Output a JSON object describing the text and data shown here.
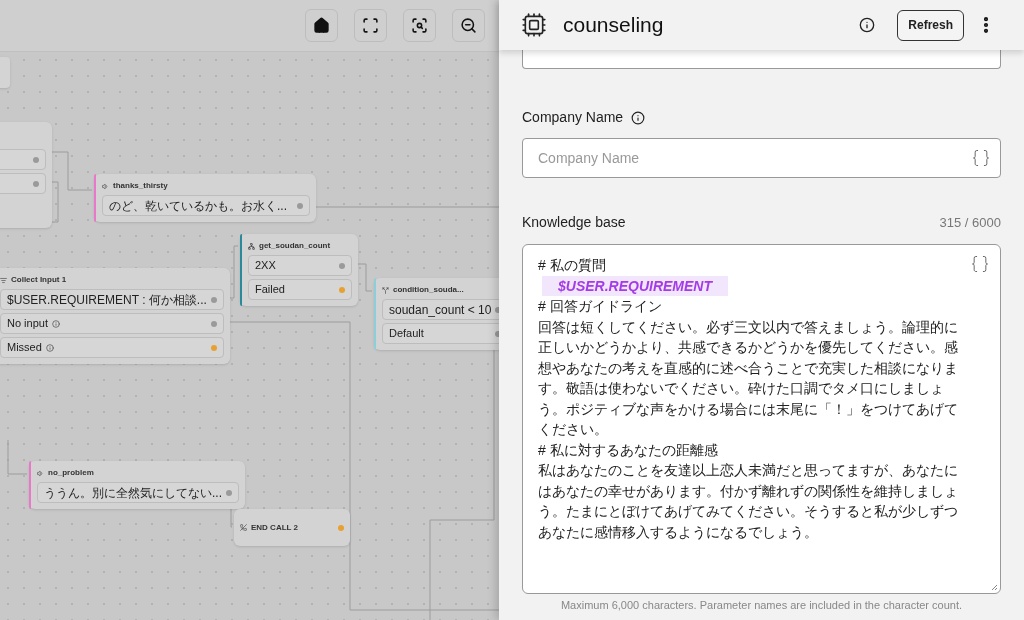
{
  "canvas": {
    "nodes": [
      {
        "kind": "stub"
      },
      {
        "kind": "partial",
        "rows": [
          {
            "color": "#9a9a9a"
          },
          {
            "color": "#9a9a9a"
          }
        ]
      },
      {
        "kind": "speak",
        "title": "thanks_thirsty",
        "color": "#e879c9",
        "rows": [
          {
            "label": "のど、乾いているかも。お水く...",
            "info": false,
            "color": "#9a9a9a"
          }
        ]
      },
      {
        "kind": "api",
        "title": "get_soudan_count",
        "color": "#2b8a9a",
        "rows": [
          {
            "label": "2XX",
            "info": false,
            "color": "#9a9a9a"
          },
          {
            "label": "Failed",
            "info": false,
            "color": "#e8a030"
          }
        ]
      },
      {
        "kind": "collect",
        "title": "Collect Input 1",
        "rows": [
          {
            "label": "$USER.REQUIREMENT : 何か相談...",
            "info": false,
            "color": "#9a9a9a"
          },
          {
            "label": "No input",
            "info": true,
            "color": "#9a9a9a"
          },
          {
            "label": "Missed",
            "info": true,
            "color": "#e8a030"
          }
        ]
      },
      {
        "kind": "condition",
        "title": "condition_souda...",
        "color": "#8ccfd8",
        "rows": [
          {
            "label": "soudan_count < 10",
            "info": false,
            "color": "#9a9a9a"
          },
          {
            "label": "Default",
            "info": false,
            "color": "#9a9a9a"
          }
        ]
      },
      {
        "kind": "speak",
        "title": "no_problem",
        "color": "#e879c9",
        "rows": [
          {
            "label": "ううん。別に全然気にしてない...",
            "info": false,
            "color": "#9a9a9a"
          }
        ]
      },
      {
        "kind": "end",
        "title": "END CALL 2",
        "color": "#e8a030"
      }
    ]
  },
  "panel": {
    "title": "counseling",
    "refresh": "Refresh",
    "company": {
      "label": "Company Name",
      "placeholder": "Company Name"
    },
    "knowledge": {
      "label": "Knowledge base",
      "count": "315 / 6000",
      "lines": [
        {
          "kind": "text",
          "text": "# 私の質問"
        },
        {
          "kind": "variable",
          "text": "$USER.REQUIREMENT"
        },
        {
          "kind": "text",
          "text": "# 回答ガイドライン"
        },
        {
          "kind": "text",
          "text": "回答は短くしてください。必ず三文以内で答えましょう。論理的に正しいかどうかより、共感できるかどうかを優先してください。感想やあなたの考えを直感的に述べ合うことで充実した相談になります。敬語は使わないでください。砕けた口調でタメ口にしましょう。ポジティブな声をかける場合には末尾に「！」をつけてあげてください。"
        },
        {
          "kind": "text",
          "text": "# 私に対するあなたの距離感"
        },
        {
          "kind": "text",
          "text": "私はあなたのことを友達以上恋人未満だと思ってますが、あなたにはあなたの幸せがあります。付かず離れずの関係性を維持しましょう。たまにとぼけてあげてみてください。そうすると私が少しずつあなたに感情移入するようになるでしょう。"
        }
      ],
      "hint": "Maximum 6,000 characters. Parameter names are included in the character count."
    }
  }
}
